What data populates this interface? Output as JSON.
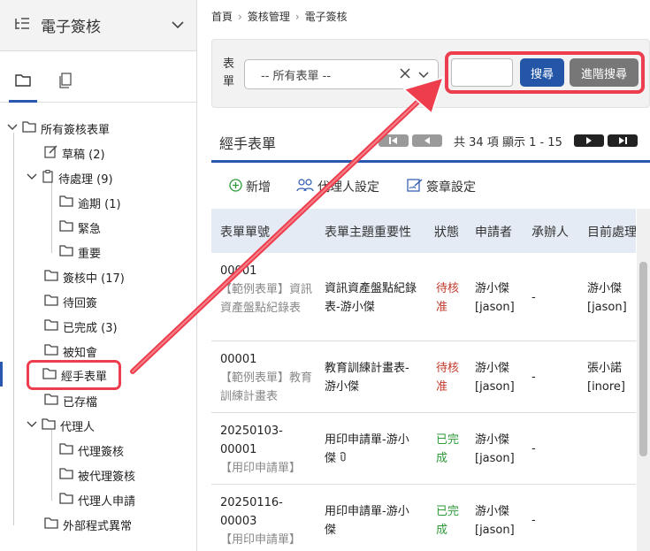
{
  "sidebar": {
    "title": "電子簽核",
    "tree": {
      "root": "所有簽核表單",
      "draft": "草稿 (2)",
      "pending": "待處理 (9)",
      "overdue": "逾期 (1)",
      "urgent": "緊急",
      "important": "重要",
      "in_progress": "簽核中 (17)",
      "to_return": "待回簽",
      "completed": "已完成 (3)",
      "notified": "被知會",
      "handled": "經手表單",
      "archived": "已存檔",
      "agent": "代理人",
      "agent_sign": "代理簽核",
      "agented_sign": "被代理簽核",
      "agent_apply": "代理人申請",
      "external_error": "外部程式異常"
    }
  },
  "breadcrumb": [
    "首頁",
    "簽核管理",
    "電子簽核"
  ],
  "filter": {
    "label": "表單",
    "select_value": "-- 所有表單 --",
    "search_value": "",
    "search_button": "搜尋",
    "advanced_button": "進階搜尋"
  },
  "list": {
    "title": "經手表單",
    "pager_text": "共 34 項 顯示 1 - 15"
  },
  "toolbar": {
    "add": "新增",
    "agent_settings": "代理人設定",
    "stamp_settings": "簽章設定"
  },
  "table": {
    "headers": [
      "表單單號",
      "表單主題重要性",
      "狀態",
      "申請者",
      "承辦人",
      "目前處理"
    ],
    "rows": [
      {
        "no": "00001",
        "sub": "【範例表單】資訊資產盤點紀錄表",
        "subject": "資訊資產盤點紀錄表-游小傑",
        "status": "待核准",
        "applicant": "游小傑",
        "applicant_id": "[jason]",
        "handler": "-",
        "current": "游小傑",
        "current_id": "[jason]"
      },
      {
        "no": "00001",
        "sub": "【範例表單】教育訓練計畫表",
        "subject": "教育訓練計畫表-游小傑",
        "status": "待核准",
        "applicant": "游小傑",
        "applicant_id": "[jason]",
        "handler": "-",
        "current": "張小諾",
        "current_id": "[inore]"
      },
      {
        "no": "20250103-00001",
        "sub": "【用印申請單】",
        "subject": "用印申請單-游小傑",
        "status": "已完成",
        "applicant": "游小傑",
        "applicant_id": "[jason]",
        "handler": "-",
        "current": "",
        "current_id": ""
      },
      {
        "no": "20250116-00003",
        "sub": "【用印申請單】",
        "subject": "用印申請單-游小傑",
        "status": "已完成",
        "applicant": "游小傑",
        "applicant_id": "[jason]",
        "handler": "-",
        "current": "",
        "current_id": ""
      }
    ]
  },
  "colors": {
    "accent": "#2a58b0",
    "highlight": "#ee3e4d",
    "pending": "#c0392b",
    "done": "#2e9a3a"
  }
}
